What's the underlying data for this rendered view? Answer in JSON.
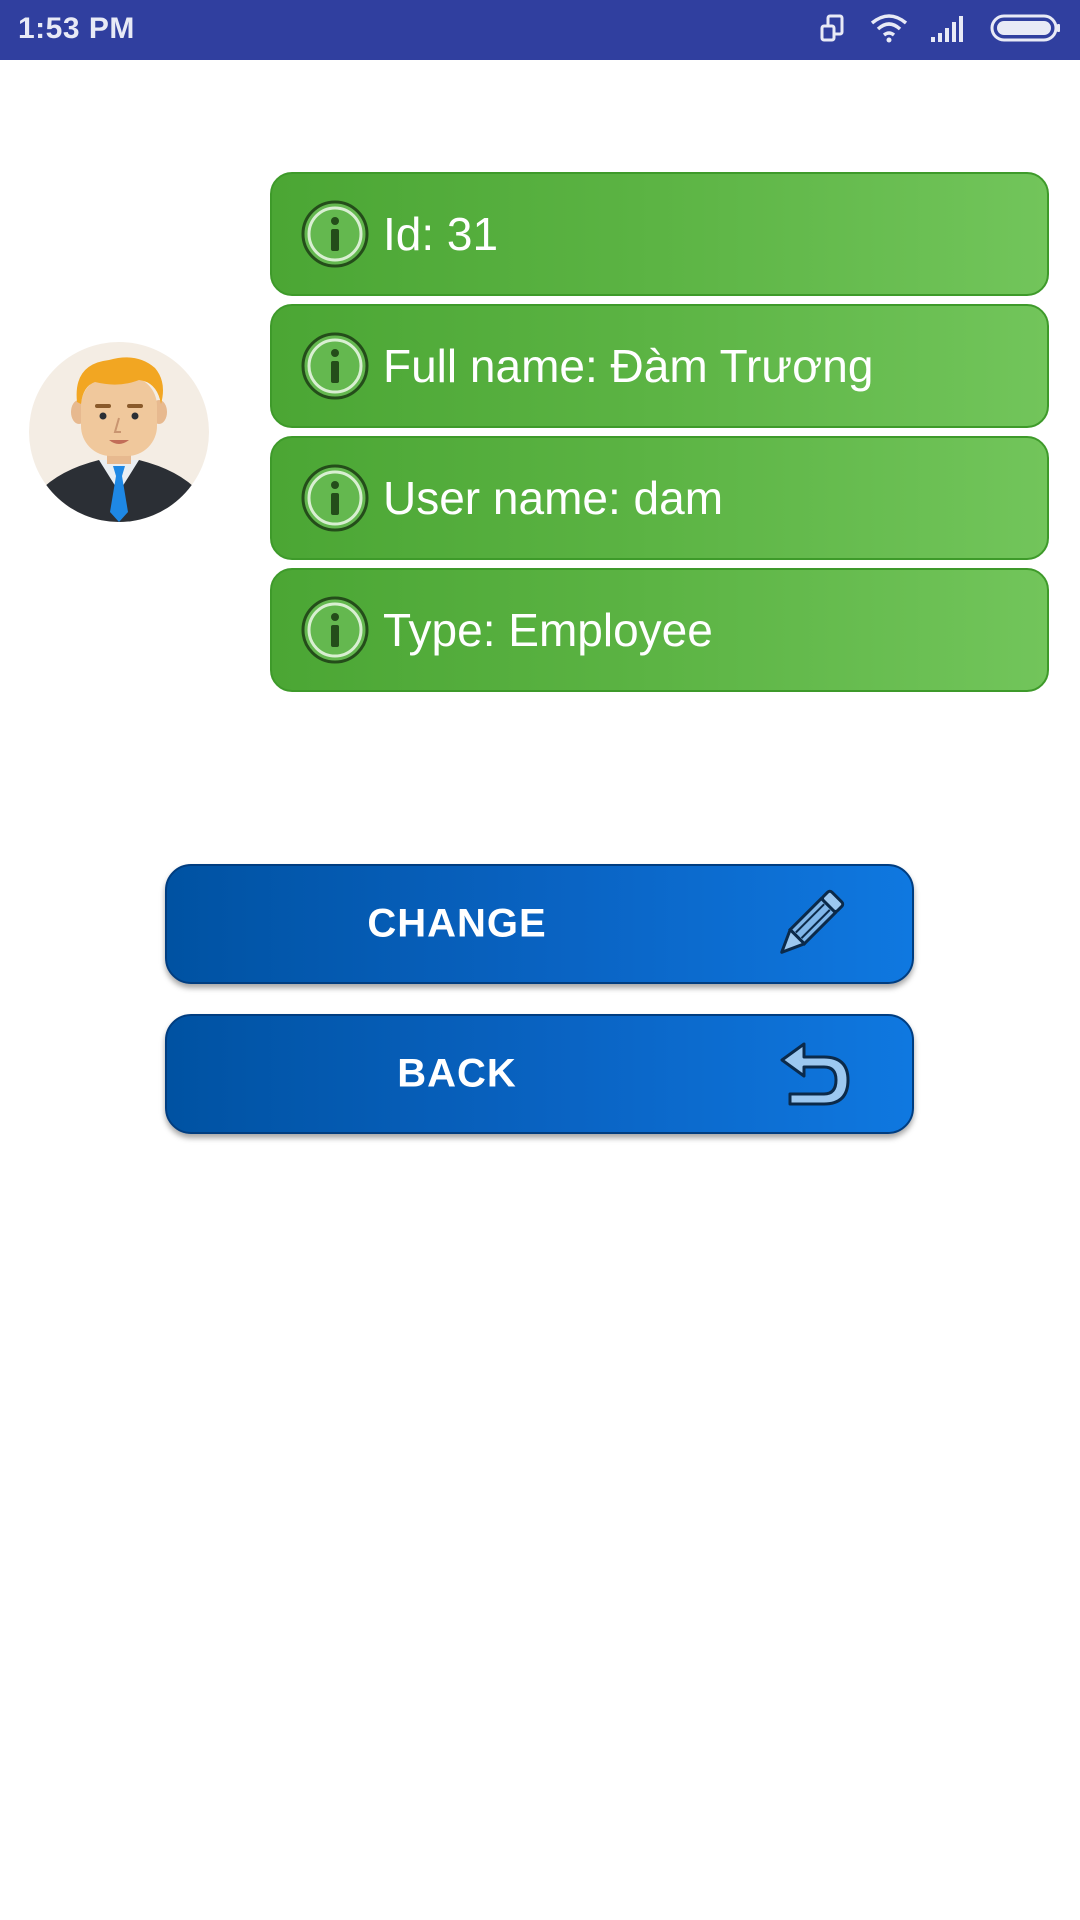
{
  "status_bar": {
    "time": "1:53 PM",
    "icons": [
      "screen-rotation-icon",
      "wifi-icon",
      "signal-icon",
      "battery-icon"
    ]
  },
  "profile": {
    "avatar_icon": "user-avatar-icon",
    "fields": [
      {
        "label": "Id: 31",
        "icon": "info-icon"
      },
      {
        "label": "Full name: Đàm Trương",
        "icon": "info-icon"
      },
      {
        "label": "User name: dam",
        "icon": "info-icon"
      },
      {
        "label": "Type: Employee",
        "icon": "info-icon"
      }
    ]
  },
  "actions": {
    "change_label": "CHANGE",
    "change_icon": "pencil-icon",
    "back_label": "BACK",
    "back_icon": "undo-arrow-icon"
  },
  "colors": {
    "status_bar": "#303f9f",
    "card_green": "#5cb444",
    "button_blue": "#0a64c4"
  }
}
